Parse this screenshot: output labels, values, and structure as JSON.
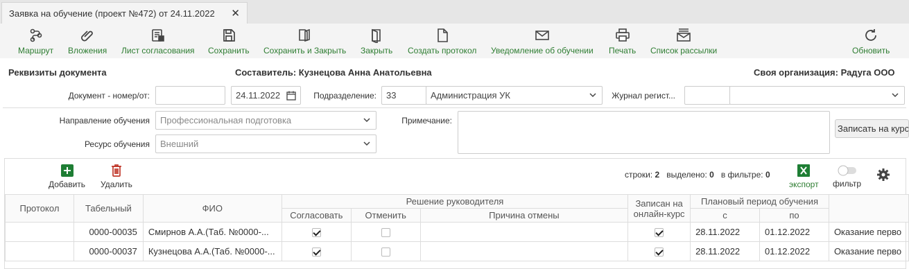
{
  "tab": {
    "title": "Заявка на обучение (проект №472) от 24.11.2022"
  },
  "toolbar": {
    "route": "Маршрут",
    "attachments": "Вложения",
    "approval_sheet": "Лист согласования",
    "save": "Сохранить",
    "save_close": "Сохранить и Закрыть",
    "close": "Закрыть",
    "create_protocol": "Создать протокол",
    "notify": "Уведомление об обучении",
    "print": "Печать",
    "mailing_list": "Список рассылки",
    "refresh": "Обновить"
  },
  "header": {
    "requisites": "Реквизиты документа",
    "author": "Составитель: Кузнецова Анна Анатольевна",
    "organization": "Своя организация: Радуга ООО"
  },
  "form": {
    "doc_label": "Документ - номер/от:",
    "doc_number": "",
    "doc_date": "24.11.2022",
    "division_label": "Подразделение:",
    "division_code": "33",
    "division_name": "Администрация УК",
    "journal_label": "Журнал регист...",
    "journal_code": "",
    "journal_name": "",
    "direction_label": "Направление обучения",
    "direction_value": "Профессиональная подготовка",
    "resource_label": "Ресурс обучения",
    "resource_value": "Внешний",
    "note_label": "Примечание:",
    "note_value": "",
    "enroll_button": "Записать на курс"
  },
  "panel": {
    "add": "Добавить",
    "delete": "Удалить",
    "rows_label": "строки:",
    "rows_count": "2",
    "selected_label": "выделено:",
    "selected_count": "0",
    "in_filter_label": "в фильтре:",
    "in_filter_count": "0",
    "export": "экспорт",
    "filter": "фильтр"
  },
  "table": {
    "headers": {
      "protocol": "Протокол",
      "tabel": "Табельный",
      "fio": "ФИО",
      "decision": "Решение руководителя",
      "approve": "Согласовать",
      "cancel": "Отменить",
      "cancel_reason": "Причина отмены",
      "online_1": "Записан на",
      "online_2": "онлайн-курс",
      "period": "Плановый период обучения",
      "from": "с",
      "to": "по"
    },
    "rows": [
      {
        "protocol": "",
        "tabel": "0000-00035",
        "fio": "Смирнов А.А.(Таб. №0000-...",
        "approve": true,
        "cancel": false,
        "reason": "",
        "online": true,
        "from": "28.11.2022",
        "to": "01.12.2022",
        "course": "Оказание перво"
      },
      {
        "protocol": "",
        "tabel": "0000-00037",
        "fio": "Кузнецова А.А.(Таб. №0000-...",
        "approve": true,
        "cancel": false,
        "reason": "",
        "online": true,
        "from": "28.11.2022",
        "to": "01.12.2022",
        "course": "Оказание перво"
      }
    ]
  }
}
